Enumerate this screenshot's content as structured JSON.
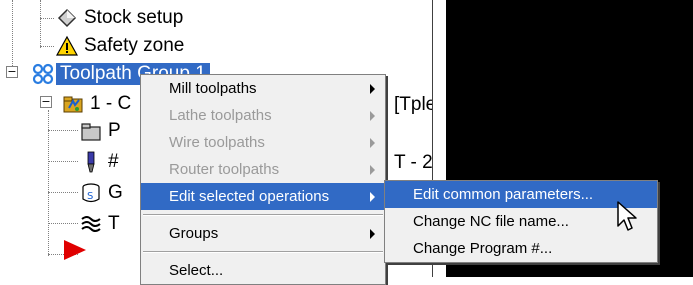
{
  "tree": {
    "items": [
      {
        "label": "Stock setup",
        "icon": "stock-setup-icon"
      },
      {
        "label": "Safety zone",
        "icon": "safety-zone-warning-icon"
      },
      {
        "label": "Toolpath Group 1",
        "icon": "toolpath-group-icon",
        "selected": true
      },
      {
        "label": "1 - C",
        "icon": "operation-folder-icon"
      },
      {
        "label": "P",
        "icon": "parameters-folder-icon"
      },
      {
        "label": "#",
        "icon": "tool-icon"
      },
      {
        "label": "G",
        "icon": "geometry-icon"
      },
      {
        "label": "T",
        "icon": "toolpath-icon"
      }
    ],
    "right_fragments": [
      "[Tple",
      "T - 2"
    ]
  },
  "context_menu": {
    "items": [
      {
        "label": "Mill toolpaths",
        "enabled": true,
        "submenu": true
      },
      {
        "label": "Lathe toolpaths",
        "enabled": false,
        "submenu": true
      },
      {
        "label": "Wire toolpaths",
        "enabled": false,
        "submenu": true
      },
      {
        "label": "Router toolpaths",
        "enabled": false,
        "submenu": true
      },
      {
        "label": "Edit selected operations",
        "enabled": true,
        "submenu": true,
        "highlighted": true
      },
      {
        "label": "Groups",
        "enabled": true,
        "submenu": true
      },
      {
        "label": "Select...",
        "enabled": true,
        "submenu": false
      }
    ]
  },
  "submenu": {
    "items": [
      {
        "label": "Edit common parameters...",
        "highlighted": true
      },
      {
        "label": "Change NC file name..."
      },
      {
        "label": "Change Program #..."
      }
    ]
  },
  "colors": {
    "highlight": "#316ac5",
    "menu_bg": "#f0f0f0",
    "disabled_text": "#9a9a9a",
    "graphics_bg": "#000000"
  }
}
